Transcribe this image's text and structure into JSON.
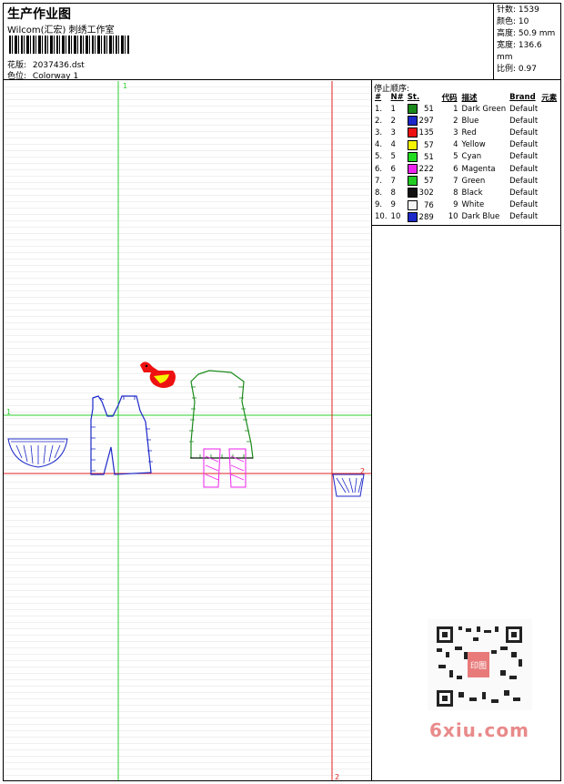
{
  "header": {
    "title": "生产作业图",
    "company": "Wilcom(汇宏) 刺绣工作室",
    "design_label": "花版:",
    "design_value": "2037436.dst",
    "colorway_label": "色位:",
    "colorway_value": "Colorway 1"
  },
  "stats": {
    "stitches": "针数: 1539",
    "colors": "颜色: 10",
    "height": "高度: 50.9 mm",
    "width": "宽度: 136.6 mm",
    "scale": "比例: 0.97"
  },
  "canvas": {
    "marker_1_top": "1",
    "marker_1_left": "1",
    "marker_2_right": "2",
    "marker_2_bottom": "2"
  },
  "stop_sequence": {
    "title": "停止顺序:",
    "headers": [
      "#",
      "N#",
      "St.",
      "代码",
      "描述",
      "Brand",
      "元素"
    ],
    "rows": [
      {
        "idx": "1.",
        "n": "1",
        "st": "51",
        "code": "1",
        "desc": "Dark Green",
        "brand": "Default",
        "color": "#1a8a1a"
      },
      {
        "idx": "2.",
        "n": "2",
        "st": "297",
        "code": "2",
        "desc": "Blue",
        "brand": "Default",
        "color": "#1c28c8"
      },
      {
        "idx": "3.",
        "n": "3",
        "st": "135",
        "code": "3",
        "desc": "Red",
        "brand": "Default",
        "color": "#ee1111"
      },
      {
        "idx": "4.",
        "n": "4",
        "st": "57",
        "code": "4",
        "desc": "Yellow",
        "brand": "Default",
        "color": "#f5f500"
      },
      {
        "idx": "5.",
        "n": "5",
        "st": "51",
        "code": "5",
        "desc": "Cyan",
        "brand": "Default",
        "color": "#22dd22"
      },
      {
        "idx": "6.",
        "n": "6",
        "st": "222",
        "code": "6",
        "desc": "Magenta",
        "brand": "Default",
        "color": "#ee22ee"
      },
      {
        "idx": "7.",
        "n": "7",
        "st": "57",
        "code": "7",
        "desc": "Green",
        "brand": "Default",
        "color": "#22cc22"
      },
      {
        "idx": "8.",
        "n": "8",
        "st": "302",
        "code": "8",
        "desc": "Black",
        "brand": "Default",
        "color": "#111111"
      },
      {
        "idx": "9.",
        "n": "9",
        "st": "76",
        "code": "9",
        "desc": "White",
        "brand": "Default",
        "color": "#f4f4f4"
      },
      {
        "idx": "10.",
        "n": "10",
        "st": "289",
        "code": "10",
        "desc": "Dark Blue",
        "brand": "Default",
        "color": "#1c28c8"
      }
    ]
  },
  "watermark": {
    "text": "6xiu.com",
    "seal_text": "印图"
  }
}
